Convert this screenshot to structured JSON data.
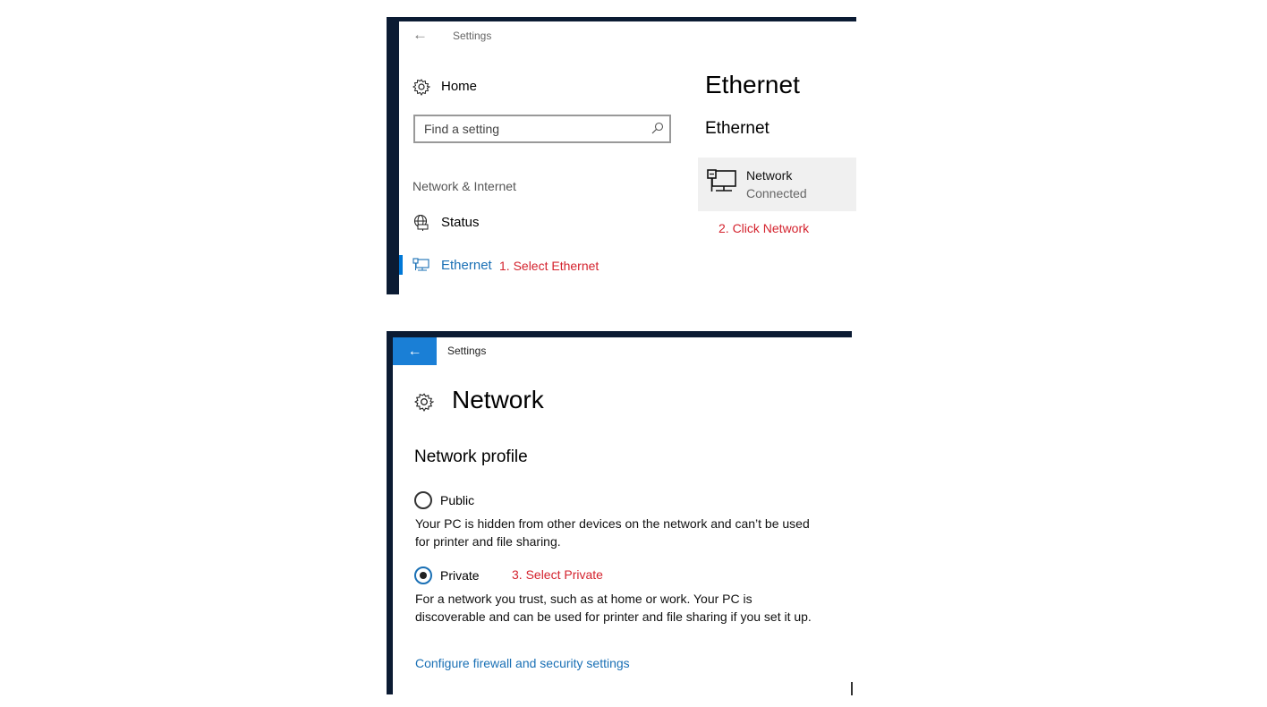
{
  "top_window": {
    "title": "Settings",
    "back_icon": "back-arrow-icon",
    "home_label": "Home",
    "search": {
      "placeholder": "Find a setting",
      "value": ""
    },
    "section_label": "Network & Internet",
    "nav_items": [
      {
        "label": "Status",
        "icon": "globe-icon",
        "selected": false
      },
      {
        "label": "Ethernet",
        "icon": "ethernet-icon",
        "selected": true
      }
    ],
    "page_title": "Ethernet",
    "subheading": "Ethernet",
    "network_card": {
      "name": "Network",
      "status": "Connected",
      "icon": "monitor-network-icon"
    },
    "annotations": {
      "step1": "1. Select Ethernet",
      "step2": "2. Click Network"
    }
  },
  "bottom_window": {
    "title": "Settings",
    "back_icon": "back-arrow-icon",
    "page_title": "Network",
    "section_title": "Network profile",
    "options": [
      {
        "label": "Public",
        "selected": false,
        "description": "Your PC is hidden from other devices on the network and can’t be used for printer and file sharing."
      },
      {
        "label": "Private",
        "selected": true,
        "description": "For a network you trust, such as at home or work. Your PC is discoverable and can be used for printer and file sharing if you set it up."
      }
    ],
    "link": "Configure firewall and security settings",
    "annotations": {
      "step3": "3. Select Private"
    }
  },
  "colors": {
    "accent": "#0078d7",
    "link": "#1a70b5",
    "annotation": "#d4232e",
    "frame": "#0b1b33"
  }
}
